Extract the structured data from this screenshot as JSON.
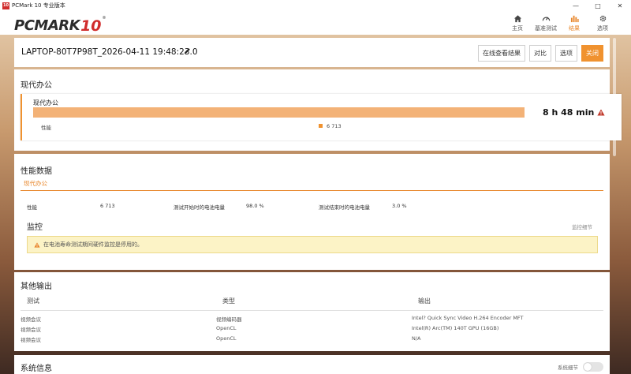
{
  "window": {
    "title": "PCMark 10 专业版本",
    "icon_text": "10",
    "icon_color": "#d02c2c"
  },
  "header": {
    "logo_text": "PCMARK",
    "logo_number": "10",
    "logo_tm": "®",
    "nav": [
      {
        "label": "主页",
        "icon": "home-icon"
      },
      {
        "label": "基准测试",
        "icon": "speedometer-icon"
      },
      {
        "label": "结果",
        "icon": "bar-chart-icon",
        "active": true
      },
      {
        "label": "选项",
        "icon": "gear-icon"
      }
    ]
  },
  "result": {
    "title": "LAPTOP-80T7P98T_2026-04-11 19:48:23.0",
    "buttons": {
      "view_online": "在线查看结果",
      "compare": "对比",
      "options": "选项",
      "close": "关闭"
    }
  },
  "modern_office": {
    "section_title": "现代办公",
    "test_name": "现代办公",
    "score": "8 h 48 min",
    "bar_fraction": 1.0,
    "perf_label": "性能",
    "perf_value": "6 713"
  },
  "perf_data": {
    "section_title": "性能数据",
    "tab": "现代办公",
    "items": [
      {
        "label": "性能",
        "value": "6 713"
      },
      {
        "label": "测试开始时的电池电量",
        "value": "98.0 %"
      },
      {
        "label": "测试结束时的电池电量",
        "value": "3.0 %"
      }
    ],
    "monitor_title": "监控",
    "monitor_link": "监控细节",
    "monitor_notice": "在电池寿命测试期间硬件监控是停用的。"
  },
  "other_output": {
    "section_title": "其他输出",
    "headers": [
      "测试",
      "类型",
      "输出"
    ],
    "rows": [
      [
        "视频会议",
        "视频编码器",
        "Intel? Quick Sync Video H.264 Encoder MFT"
      ],
      [
        "视频会议",
        "OpenCL",
        "Intel(R) Arc(TM) 140T GPU (16GB)"
      ],
      [
        "视频会议",
        "OpenCL",
        "N/A"
      ]
    ]
  },
  "system_info": {
    "section_title": "系统信息",
    "toggle_label": "系统细节"
  },
  "colors": {
    "accent": "#f0922f",
    "bar": "#f3b277",
    "warning": "#c0392b"
  }
}
